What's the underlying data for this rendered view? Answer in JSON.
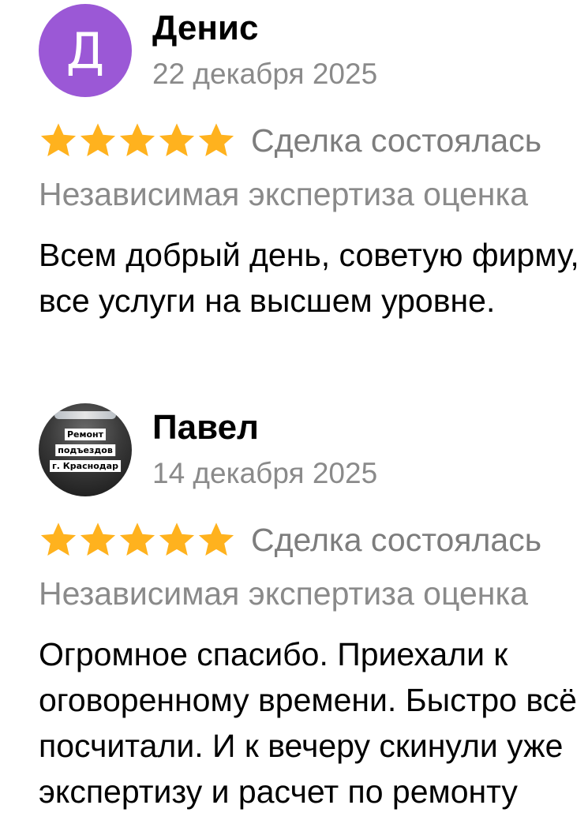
{
  "colors": {
    "star": "#ffb21e",
    "avatar_purple": "#9b58d6",
    "muted_text": "#8a8a8a"
  },
  "reviews": [
    {
      "avatar": {
        "type": "letter",
        "letter": "Д"
      },
      "author": "Денис",
      "date": "22 декабря 2025",
      "rating": 5,
      "deal_status": "Сделка состоялась",
      "service": "Независимая экспертиза оценка",
      "text_lines": [
        "Всем добрый день, советую фирму,",
        "все услуги на высшем уровне."
      ]
    },
    {
      "avatar": {
        "type": "photo",
        "photo_text": [
          "Ремонт",
          "подъездов",
          "г. Краснодар"
        ]
      },
      "author": "Павел",
      "date": "14 декабря 2025",
      "rating": 5,
      "deal_status": "Сделка состоялась",
      "service": "Независимая экспертиза оценка",
      "text_lines": [
        "Огромное спасибо. Приехали к",
        "оговоренному времени. Быстро всё",
        "посчитали. И к вечеру скинули уже",
        "экспертизу и расчет по ремонту"
      ]
    }
  ]
}
